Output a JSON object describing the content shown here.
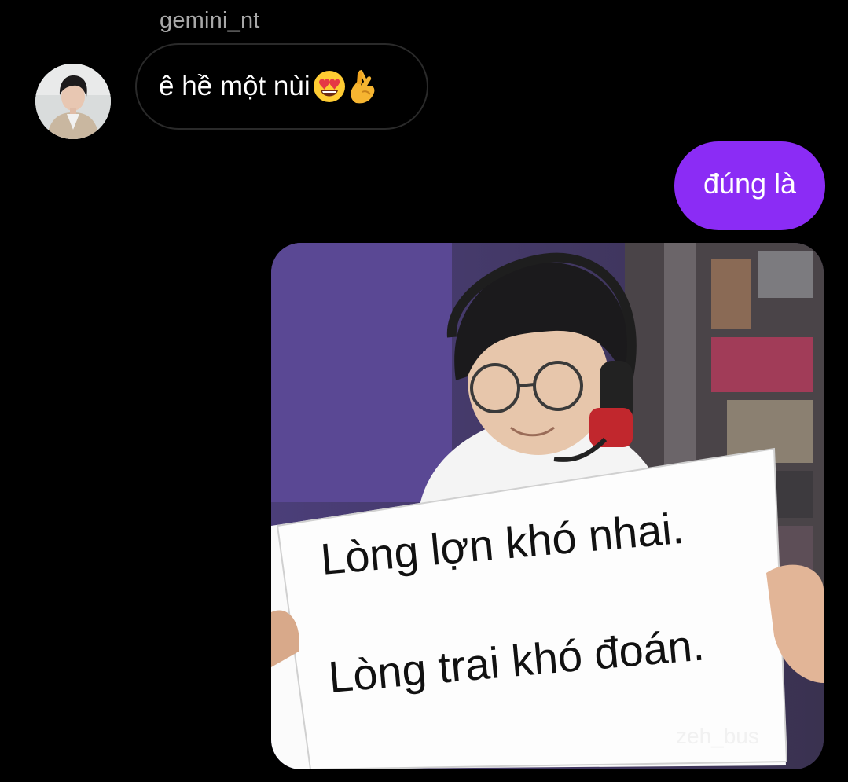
{
  "thread": {
    "sender_name": "gemini_nt",
    "incoming": {
      "text": "ê hề một nùi",
      "emojis": [
        "heart-eyes-emoji",
        "crossed-fingers-heart-emoji"
      ]
    },
    "outgoing": {
      "text": "đúng là"
    },
    "image_message": {
      "sign_line_1": "Lòng lợn khó nhai.",
      "sign_line_2": "Lòng trai khó đoán.",
      "watermark": "zeh_bus"
    }
  },
  "colors": {
    "background": "#000000",
    "outgoing_bubble": "#8b2cf5",
    "incoming_border": "#2a2a2a",
    "sender_name": "#a8a8a8",
    "text": "#ffffff"
  }
}
